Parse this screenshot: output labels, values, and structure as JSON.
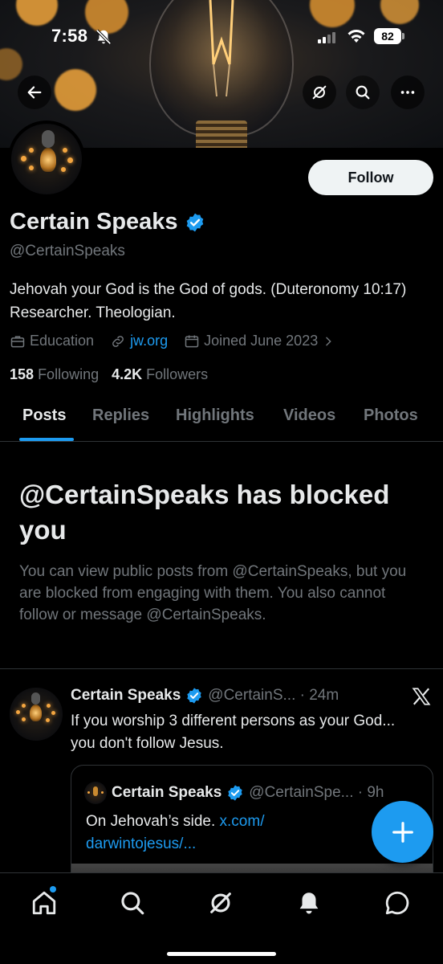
{
  "status_bar": {
    "time": "7:58",
    "battery": "82",
    "icons": [
      "bell-off-icon",
      "cellular-signal-icon",
      "wifi-icon",
      "battery-icon"
    ]
  },
  "banner": {
    "buttons": [
      "back-arrow-icon",
      "grok-icon",
      "search-icon",
      "more-icon"
    ]
  },
  "profile": {
    "display_name": "Certain Speaks",
    "handle": "@CertainSpeaks",
    "follow_label": "Follow",
    "bio": "Jehovah your God is the God of gods. (Duteronomy 10:17) Researcher. Theologian.",
    "category": "Education",
    "website": "jw.org",
    "joined": "Joined June 2023",
    "following_count": "158",
    "following_label": "Following",
    "followers_count": "4.2K",
    "followers_label": "Followers"
  },
  "tabs": [
    {
      "label": "Posts",
      "active": true
    },
    {
      "label": "Replies",
      "active": false
    },
    {
      "label": "Highlights",
      "active": false
    },
    {
      "label": "Videos",
      "active": false
    },
    {
      "label": "Photos",
      "active": false
    }
  ],
  "blocked": {
    "title": "@CertainSpeaks has blocked you",
    "message": "You can view public posts from @CertainSpeaks, but you are blocked from engaging with them. You also cannot follow or message @CertainSpeaks."
  },
  "post": {
    "name": "Certain Speaks",
    "handle_time": "@CertainS... · 24m",
    "text": "If you worship 3 different persons as your God... you don't follow Jesus.",
    "quote": {
      "name": "Certain Speaks",
      "handle_time": "@CertainSpe... · 9h",
      "text": "On Jehovah’s side.",
      "link_line1": "x.com/",
      "link_line2": "darwintojesus/..."
    }
  },
  "bottom_nav": [
    "home-icon",
    "search-icon",
    "grok-icon",
    "notifications-icon",
    "messages-icon"
  ],
  "colors": {
    "accent": "#1d9bf0",
    "background": "#000000",
    "text": "#e7e9ea",
    "secondary_text": "#71767b"
  }
}
